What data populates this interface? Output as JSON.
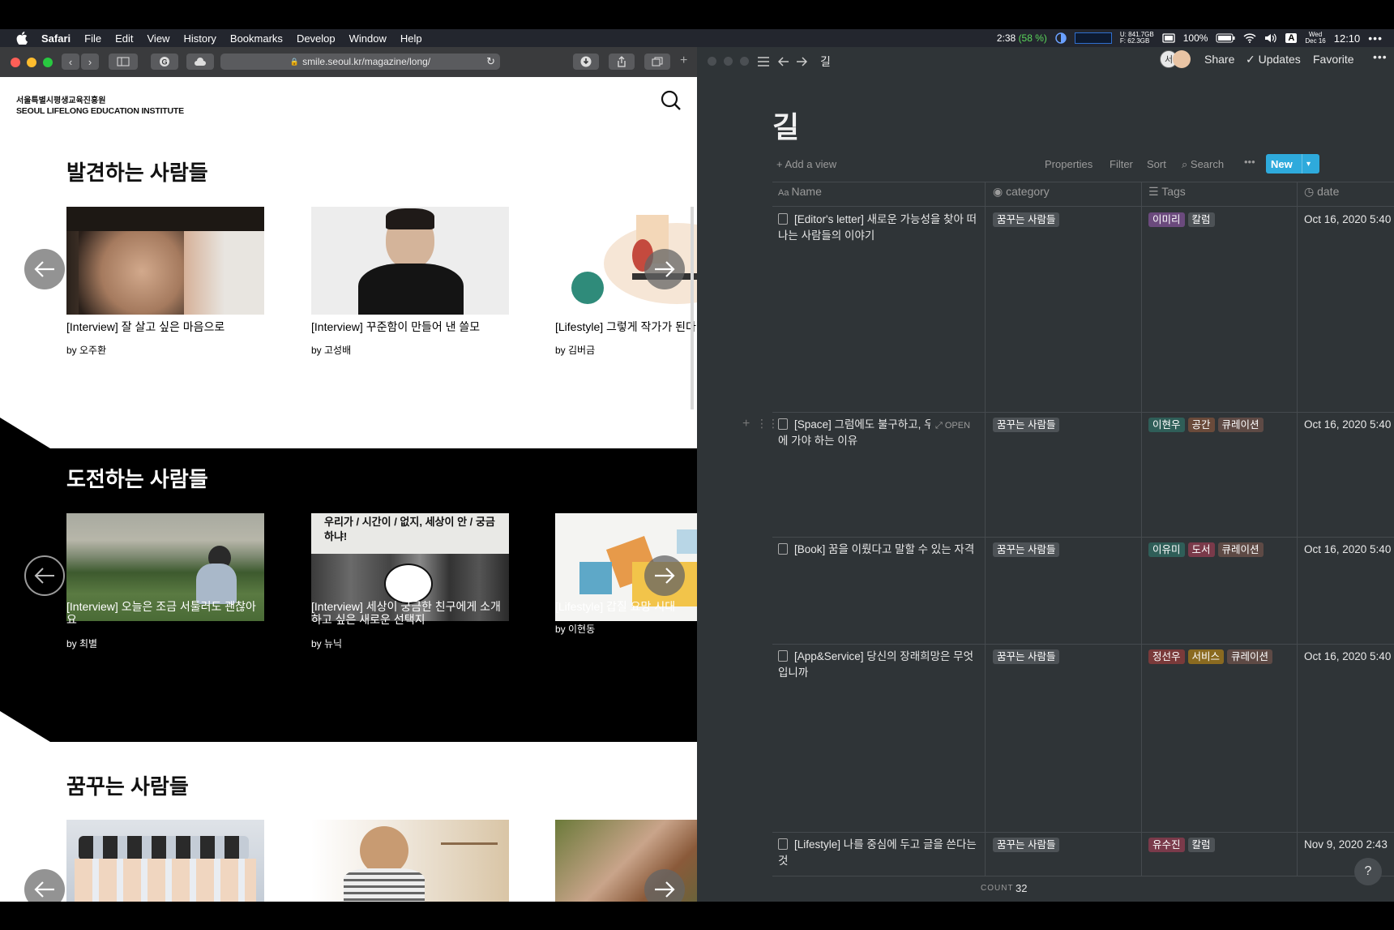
{
  "menubar": {
    "app": "Safari",
    "items": [
      "File",
      "Edit",
      "View",
      "History",
      "Bookmarks",
      "Develop",
      "Window",
      "Help"
    ],
    "status": {
      "timer": "2:38",
      "timer_pct": "(58 %)",
      "disk_used": "U: 841.7GB",
      "disk_free": "F: 62.3GB",
      "battery": "100%",
      "input": "A",
      "weekday": "Wed",
      "date": "Dec 16",
      "time": "12:10"
    }
  },
  "safari": {
    "url": "smile.seoul.kr/magazine/long/",
    "site": {
      "logo_ko": "서울특별시평생교육진흥원",
      "logo_en": "SEOUL LIFELONG EDUCATION INSTITUTE"
    },
    "sections": [
      {
        "title": "발견하는 사람들",
        "cards": [
          {
            "caption": "[Interview] 잘 살고 싶은 마음으로",
            "by": "by 오주환"
          },
          {
            "caption": "[Interview] 꾸준함이 만들어 낸 쓸모",
            "by": "by 고성배"
          },
          {
            "caption": "[Lifestyle] 그렇게 작가가 된다",
            "by": "by 김버금"
          }
        ]
      },
      {
        "title": "도전하는 사람들",
        "cards": [
          {
            "caption": "[Interview] 오늘은 조금 서툴러도 괜찮아요",
            "by": "by 최별"
          },
          {
            "caption": "[Interview] 세상이 궁금한 친구에게 소개하고 싶은 새로운 선택지",
            "by": "by 뉴닉",
            "image_text": "우리가 / 시간이 / 없지, 세상이 안 / 궁금하냐!"
          },
          {
            "caption": "[Lifestyle] 갑질 요망 시대",
            "by": "by 이현동"
          }
        ]
      },
      {
        "title": "꿈꾸는 사람들",
        "cards": []
      }
    ]
  },
  "notion": {
    "breadcrumb": "길",
    "topbar": {
      "avatar": "서",
      "share": "Share",
      "updates": "Updates",
      "favorite": "Favorite"
    },
    "title": "길",
    "toolbar": {
      "add_view": "Add a view",
      "properties": "Properties",
      "filter": "Filter",
      "sort": "Sort",
      "search": "Search",
      "new": "New"
    },
    "columns": [
      "Name",
      "category",
      "Tags",
      "date"
    ],
    "rows": [
      {
        "name": "[Editor's letter] 새로운 가능성을 찾아 떠나는 사람들의 이야기",
        "category": "꿈꾸는 사람들",
        "tags": [
          {
            "t": "이미리",
            "c": "#6b4a7d"
          },
          {
            "t": "칼럼",
            "c": "#4d5256"
          }
        ],
        "date": "Oct 16, 2020 5:40"
      },
      {
        "name": "[Space] 그럼에도 불구하고, 우리가 공간에 가야 하는 이유",
        "open": "OPEN",
        "category": "꿈꾸는 사람들",
        "tags": [
          {
            "t": "이현우",
            "c": "#2f5e58"
          },
          {
            "t": "공간",
            "c": "#6a4a3a"
          },
          {
            "t": "큐레이션",
            "c": "#5e4a45"
          }
        ],
        "date": "Oct 16, 2020 5:40"
      },
      {
        "name": "[Book] 꿈을 이뤘다고 말할 수 있는 자격",
        "category": "꿈꾸는 사람들",
        "tags": [
          {
            "t": "이유미",
            "c": "#2f5e58"
          },
          {
            "t": "도서",
            "c": "#7a3a4a"
          },
          {
            "t": "큐레이션",
            "c": "#5e4a45"
          }
        ],
        "date": "Oct 16, 2020 5:40"
      },
      {
        "name": "[App&Service] 당신의 장래희망은 무엇입니까",
        "category": "꿈꾸는 사람들",
        "tags": [
          {
            "t": "정선우",
            "c": "#7a3a3a"
          },
          {
            "t": "서비스",
            "c": "#8a6a20"
          },
          {
            "t": "큐레이션",
            "c": "#5e4a45"
          }
        ],
        "date": "Oct 16, 2020 5:40"
      },
      {
        "name": "[Lifestyle] 나를 중심에 두고 글을 쓴다는 것",
        "category": "꿈꾸는 사람들",
        "tags": [
          {
            "t": "유수진",
            "c": "#7a3a4a"
          },
          {
            "t": "칼럼",
            "c": "#4d5256"
          }
        ],
        "date": "Nov 9, 2020 2:43"
      }
    ],
    "count_label": "COUNT",
    "count_value": "32",
    "help": "?"
  },
  "colors": {
    "notion_bg": "#2f3437",
    "new_button": "#2eaadc",
    "menubar": "#23262e"
  }
}
